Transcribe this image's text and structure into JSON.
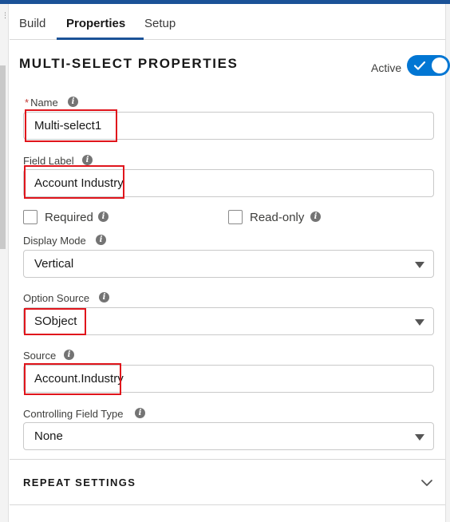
{
  "tabs": [
    {
      "label": "Build"
    },
    {
      "label": "Properties"
    },
    {
      "label": "Setup"
    }
  ],
  "panel": {
    "title": "MULTI-SELECT PROPERTIES",
    "active_label": "Active",
    "active_toggle_on": true
  },
  "fields": {
    "name": {
      "required_mark": "*",
      "label": "Name",
      "value": "Multi-select1"
    },
    "field_label": {
      "label": "Field Label",
      "value": "Account Industry"
    },
    "required": {
      "label": "Required",
      "checked": false
    },
    "read_only": {
      "label": "Read-only",
      "checked": false
    },
    "display_mode": {
      "label": "Display Mode",
      "value": "Vertical"
    },
    "option_source": {
      "label": "Option Source",
      "value": "SObject"
    },
    "source": {
      "label": "Source",
      "value": "Account.Industry"
    },
    "controlling_field_type": {
      "label": "Controlling Field Type",
      "value": "None"
    }
  },
  "repeat_settings": {
    "title": "REPEAT SETTINGS"
  },
  "icons": {
    "info": "info-icon",
    "toggle_check": "check-icon",
    "dropdown": "caret-down-icon",
    "section_toggle": "chevron-down-icon"
  },
  "colors": {
    "accent": "#0176d3",
    "tab_underline": "#1b5297",
    "highlight": "#e0151c"
  }
}
